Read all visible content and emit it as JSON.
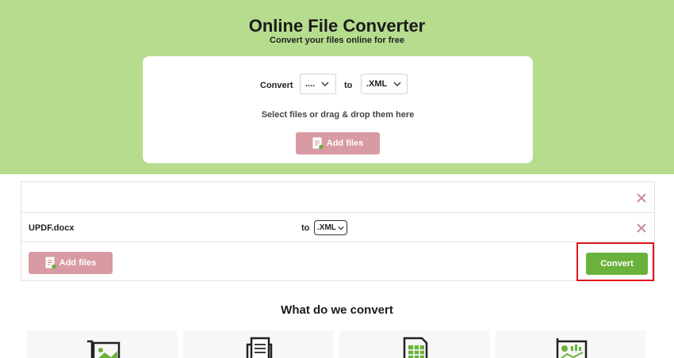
{
  "hero": {
    "title": "Online File Converter",
    "subtitle": "Convert your files online for free"
  },
  "converter": {
    "convert_label": "Convert",
    "from_value": "....",
    "to_label": "to",
    "to_value": ".XML",
    "drop_text": "Select files or drag & drop them here",
    "add_files_label": "Add files"
  },
  "file_list": {
    "files": [
      {
        "name": "UPDF.docx",
        "to_label": "to",
        "format": ".XML"
      }
    ],
    "add_files_label": "Add files",
    "convert_label": "Convert"
  },
  "section": {
    "title": "What do we convert"
  },
  "icons": {
    "add_files": "document-add-icon",
    "remove": "close-icon",
    "dropdown": "chevron-down-icon",
    "tiles": [
      "image-icon",
      "document-icon",
      "spreadsheet-icon",
      "presentation-icon"
    ]
  },
  "colors": {
    "hero_bg": "#b6dc8e",
    "add_button": "#d89aa3",
    "convert_button": "#6ab23c",
    "highlight": "#e0141e",
    "remove_icon": "#c98b95"
  }
}
